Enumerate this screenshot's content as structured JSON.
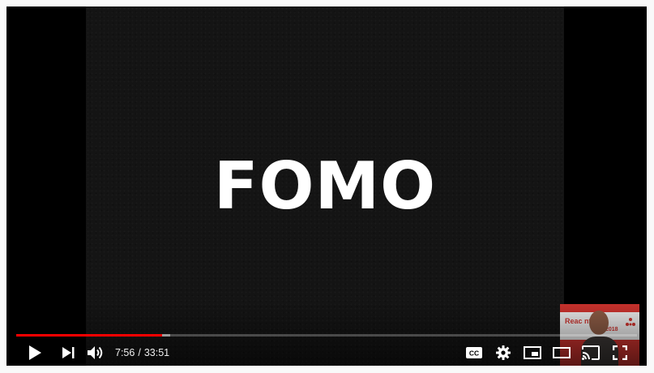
{
  "video": {
    "slide_title": "FOMO",
    "progress_fraction": 0.235,
    "loaded_fraction": 0.248
  },
  "pip": {
    "banner_text": "Reac       nte",
    "banner_year": "2018"
  },
  "time": {
    "current": "7:56",
    "separator": "/",
    "duration": "33:51"
  },
  "controls": {
    "play": "play-icon",
    "next": "next-icon",
    "volume": "volume-icon",
    "captions": "captions-icon",
    "captions_label": "CC",
    "settings": "gear-icon",
    "miniplayer": "miniplayer-icon",
    "theater": "theater-mode-icon",
    "cast": "cast-icon",
    "fullscreen": "fullscreen-icon"
  },
  "colors": {
    "progress_played": "#ff0000",
    "page_background": "#f9f9f9",
    "player_background": "#000000"
  }
}
